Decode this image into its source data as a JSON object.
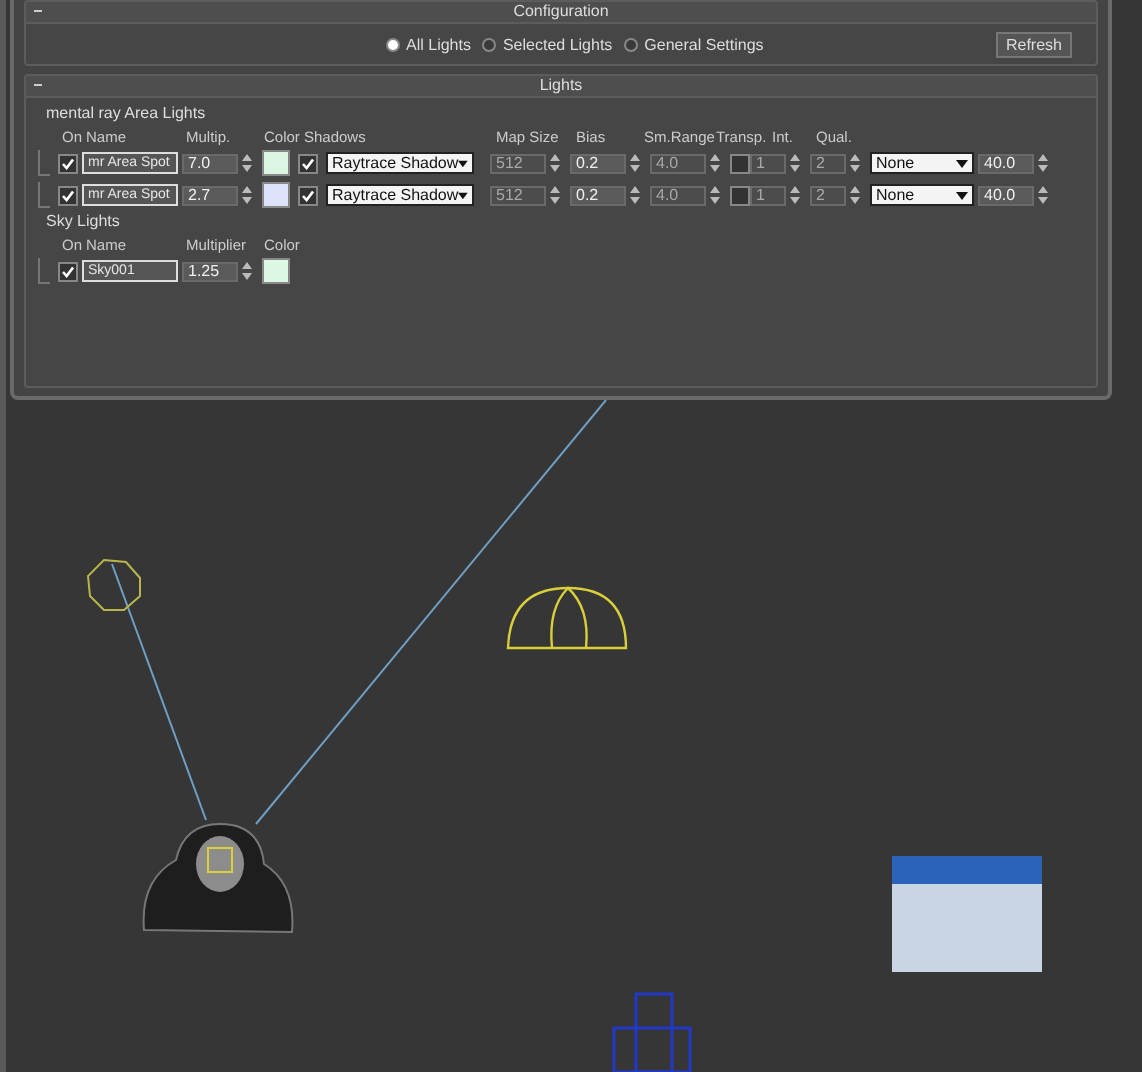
{
  "configuration": {
    "title": "Configuration",
    "options": [
      {
        "label": "All Lights",
        "selected": true
      },
      {
        "label": "Selected Lights",
        "selected": false
      },
      {
        "label": "General Settings",
        "selected": false
      }
    ],
    "refresh": "Refresh"
  },
  "lights": {
    "title": "Lights",
    "area_group": {
      "title": "mental ray Area Lights",
      "columns": [
        "On",
        "Name",
        "Multip.",
        "Color",
        "Shadows",
        "Map Size",
        "Bias",
        "Sm.Range",
        "Transp.",
        "Int.",
        "Qual."
      ],
      "rows": [
        {
          "on": true,
          "name": "mr Area Spot",
          "multiplier": "7.0",
          "color": "#dcf5e2",
          "shadows": true,
          "shadow_type": "Raytrace Shadow",
          "map_size": {
            "value": "512",
            "disabled": true
          },
          "bias": {
            "value": "0.2",
            "disabled": false
          },
          "sm_range": {
            "value": "4.0",
            "disabled": true
          },
          "transparency": false,
          "int": {
            "value": "1",
            "disabled": true
          },
          "qual": {
            "value": "2",
            "disabled": true
          },
          "decay": "None",
          "decay_value": "40.0"
        },
        {
          "on": true,
          "name": "mr Area Spot",
          "multiplier": "2.7",
          "color": "#dde3f8",
          "shadows": true,
          "shadow_type": "Raytrace Shadow",
          "map_size": {
            "value": "512",
            "disabled": true
          },
          "bias": {
            "value": "0.2",
            "disabled": false
          },
          "sm_range": {
            "value": "4.0",
            "disabled": true
          },
          "transparency": false,
          "int": {
            "value": "1",
            "disabled": true
          },
          "qual": {
            "value": "2",
            "disabled": true
          },
          "decay": "None",
          "decay_value": "40.0"
        }
      ]
    },
    "sky_group": {
      "title": "Sky Lights",
      "columns": [
        "On",
        "Name",
        "Multiplier",
        "Color"
      ],
      "rows": [
        {
          "on": true,
          "name": "Sky001",
          "multiplier": "1.25",
          "color": "#dcf7e4"
        }
      ]
    }
  }
}
